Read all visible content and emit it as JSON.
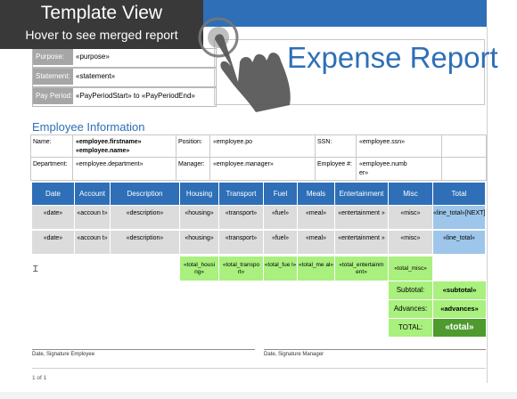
{
  "overlay": {
    "title": "Template View",
    "subtitle": "Hover to see merged report"
  },
  "header_fields": [
    {
      "label": "Purpose:",
      "value": "«purpose»"
    },
    {
      "label": "Statement:",
      "value": "«statement»"
    },
    {
      "label": "Pay Period:",
      "value": "«PayPeriodStart» to «PayPeriodEnd»"
    }
  ],
  "report_title": "Expense Report",
  "section_title": "Employee Information",
  "employee": {
    "name_label": "Name:",
    "name_value_1": "«employee.firstname»",
    "name_value_2": "«employee.name»",
    "position_label": "Position:",
    "position_value": "«employee.po",
    "ssn_label": "SSN:",
    "ssn_value": "«employee.ssn»",
    "department_label": "Department:",
    "department_value": "«employee.department»",
    "manager_label": "Manager:",
    "manager_value": "«employee.manager»",
    "empnum_label": "Employee #:",
    "empnum_value_1": "«employee.numb",
    "empnum_value_2": "er»"
  },
  "table": {
    "headers": [
      "Date",
      "Account",
      "Description",
      "Housing",
      "Transport",
      "Fuel",
      "Meals",
      "Entertainment",
      "Misc",
      "Total"
    ],
    "rows": [
      [
        "«date»",
        "«accoun t»",
        "«description»",
        "«housing»",
        "«transport»",
        "«fuel»",
        "«meal»",
        "«entertainment »",
        "«misc»",
        "«line_total»[NEXT]"
      ],
      [
        "«date»",
        "«accoun t»",
        "«description»",
        "«housing»",
        "«transport»",
        "«fuel»",
        "«meal»",
        "«entertainment »",
        "«misc»",
        "«line_total»"
      ]
    ],
    "totals": [
      "«total_housi ng»",
      "«total_transpo rt»",
      "«total_fue l»",
      "«total_me al»",
      "«total_entertainm ent»",
      "«total_misc»"
    ],
    "summary": [
      {
        "label": "Subtotal:",
        "value": "«subtotal»"
      },
      {
        "label": "Advances:",
        "value": "«advances»"
      },
      {
        "label": "TOTAL:",
        "value": "«total»"
      }
    ]
  },
  "signatures": {
    "employee": "Date, Signature Employee",
    "manager": "Date, Signature Manager"
  },
  "footer": {
    "page": "1 of 1"
  },
  "icons": {
    "hand": "hand-pointer-icon",
    "cursor": "text-cursor-icon"
  },
  "colors": {
    "accent": "#2e6fb7",
    "header_gray": "#a6a6a6",
    "total_green": "#a9f07e",
    "grand_total": "#4e9a2e"
  }
}
